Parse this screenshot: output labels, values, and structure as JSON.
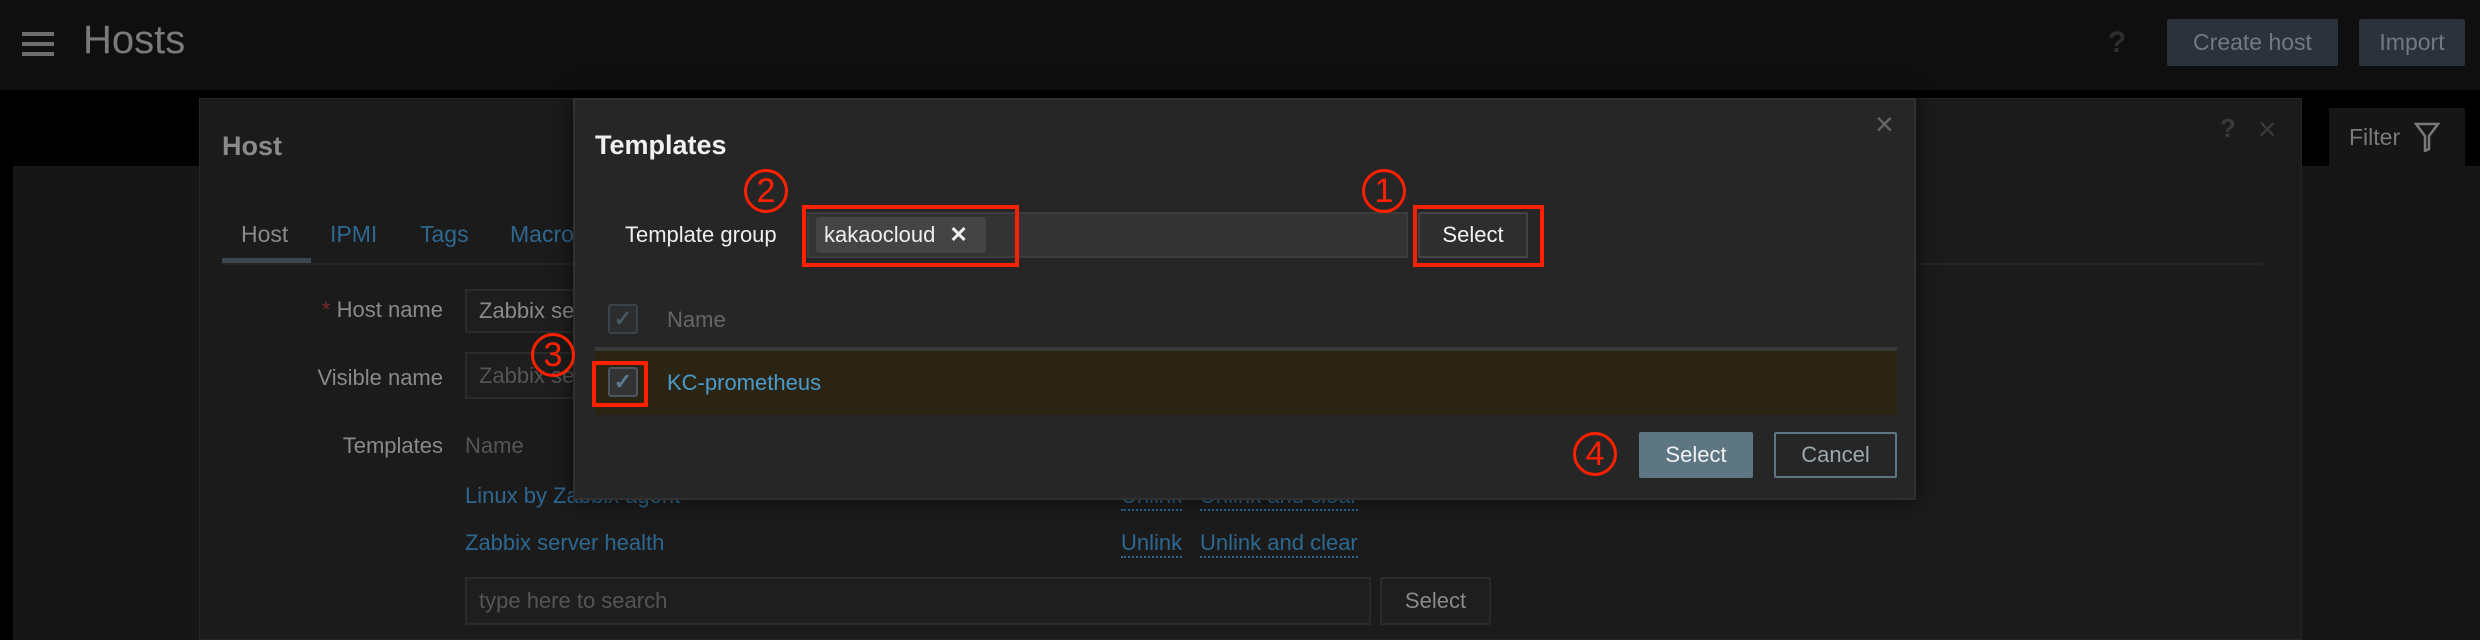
{
  "header": {
    "title": "Hosts",
    "help": "?",
    "create_host": "Create host",
    "import": "Import",
    "filter": "Filter"
  },
  "host_dialog": {
    "title": "Host",
    "help": "?",
    "close": "×",
    "tabs": [
      {
        "label": "Host",
        "active": true
      },
      {
        "label": "IPMI"
      },
      {
        "label": "Tags"
      },
      {
        "label": "Macros"
      }
    ],
    "required_mark": "*",
    "host_name_label": "Host name",
    "host_name_value": "Zabbix server",
    "visible_name_label": "Visible name",
    "visible_name_placeholder": "Zabbix server",
    "templates_label": "Templates",
    "templates_col_name": "Name",
    "templates": [
      {
        "name": "Linux by Zabbix agent",
        "unlink": "Unlink",
        "unlink_clear": "Unlink and clear"
      },
      {
        "name": "Zabbix server health",
        "unlink": "Unlink",
        "unlink_clear": "Unlink and clear"
      }
    ],
    "search_placeholder": "type here to search",
    "select": "Select"
  },
  "templates_dialog": {
    "title": "Templates",
    "close": "×",
    "group_label": "Template group",
    "group_chip": "kakaocloud",
    "chip_remove": "✕",
    "group_select": "Select",
    "col_name": "Name",
    "rows": [
      {
        "name": "KC-prometheus",
        "checked": true
      }
    ],
    "select": "Select",
    "cancel": "Cancel"
  },
  "annotations": {
    "step1": "1",
    "step2": "2",
    "step3": "3",
    "step4": "4",
    "color": "#ff2000"
  },
  "colors": {
    "link": "#4a9acb",
    "row_highlight": "#2c2412",
    "primary_button": "#5e7682"
  }
}
